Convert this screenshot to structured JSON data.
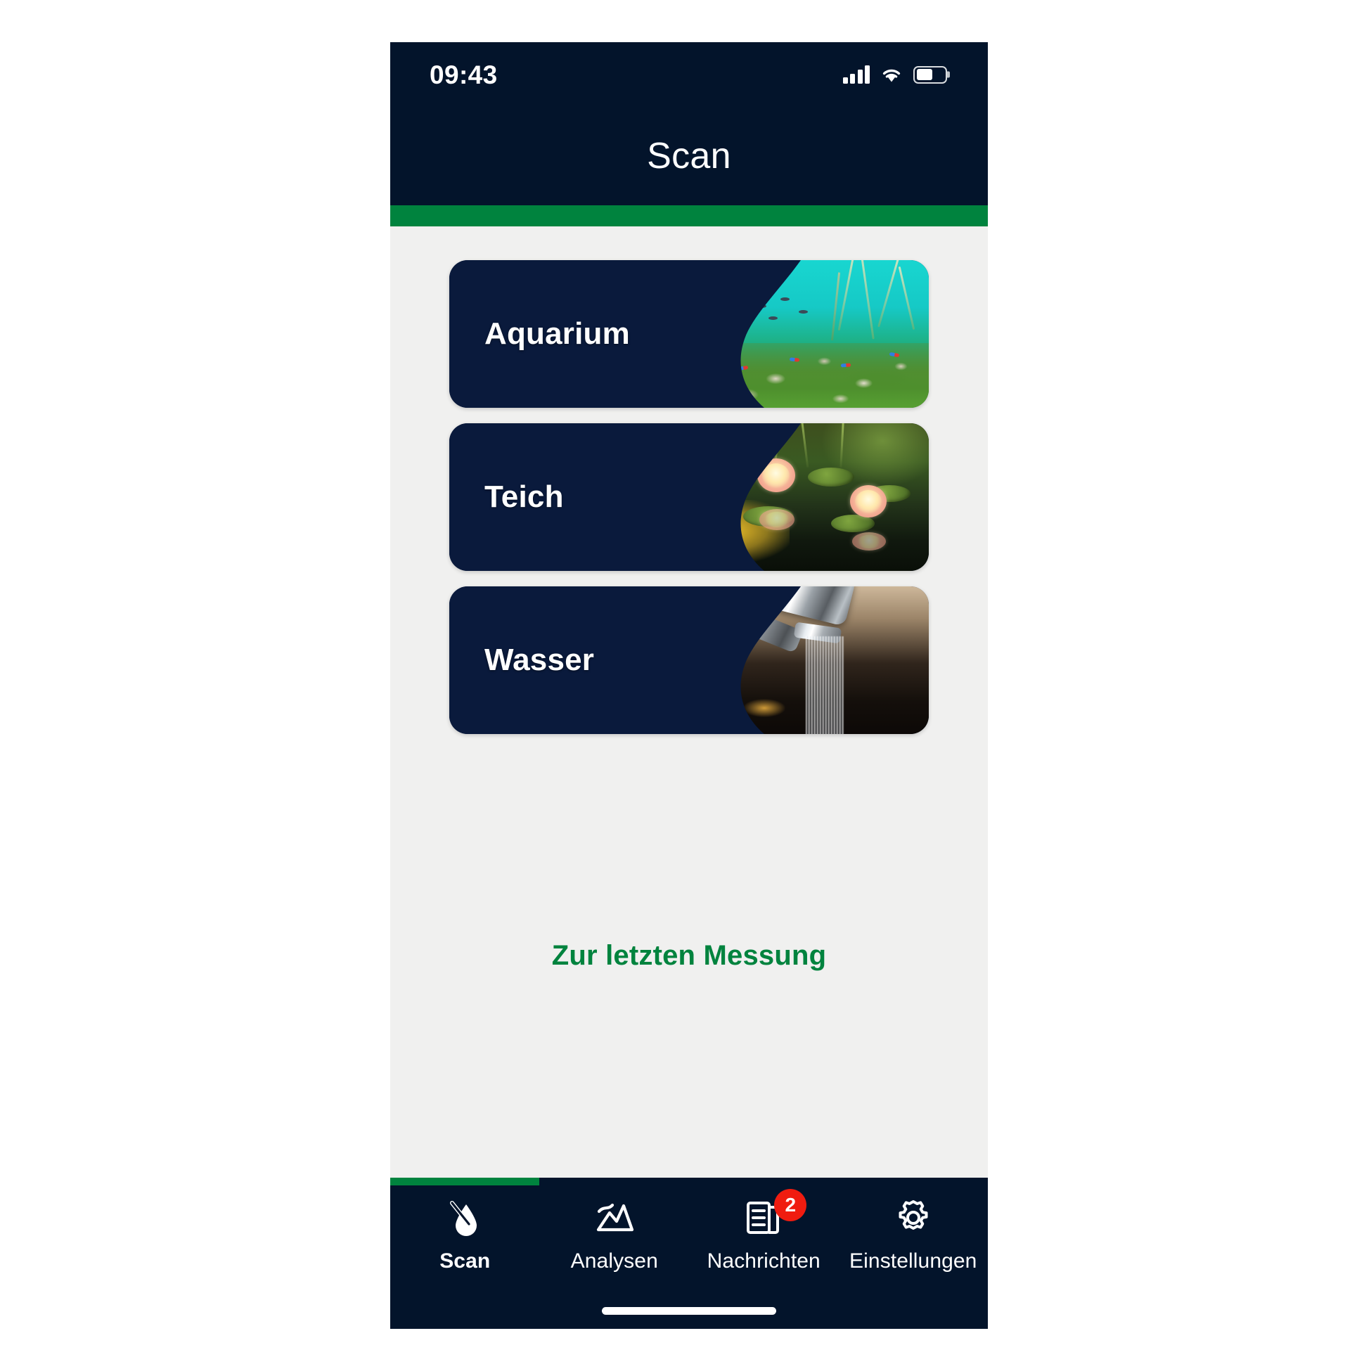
{
  "status_bar": {
    "time": "09:43",
    "signal_icon": "cellular-signal-icon",
    "wifi_icon": "wifi-icon",
    "battery_icon": "battery-icon",
    "battery_level_percent": 58
  },
  "header": {
    "title": "Scan",
    "background_color": "#03142b",
    "accent_color": "#00833e"
  },
  "cards": [
    {
      "label": "Aquarium",
      "image": "aquarium-photo",
      "name": "card-aquarium"
    },
    {
      "label": "Teich",
      "image": "pond-photo",
      "name": "card-teich"
    },
    {
      "label": "Wasser",
      "image": "faucet-photo",
      "name": "card-wasser"
    }
  ],
  "last_measurement_link": {
    "label": "Zur letzten Messung",
    "color": "#00833e"
  },
  "tabbar": {
    "background_color": "#03142b",
    "active_indicator_color": "#00833e",
    "items": [
      {
        "label": "Scan",
        "icon": "water-drop-scan-icon",
        "active": true,
        "badge": null
      },
      {
        "label": "Analysen",
        "icon": "chart-mountain-icon",
        "active": false,
        "badge": null
      },
      {
        "label": "Nachrichten",
        "icon": "newspaper-icon",
        "active": false,
        "badge": "2"
      },
      {
        "label": "Einstellungen",
        "icon": "gear-icon",
        "active": false,
        "badge": null
      }
    ],
    "badge_color": "#f01c10"
  },
  "page_background": "#f0f0ef",
  "card_background": "#0a1a3c"
}
